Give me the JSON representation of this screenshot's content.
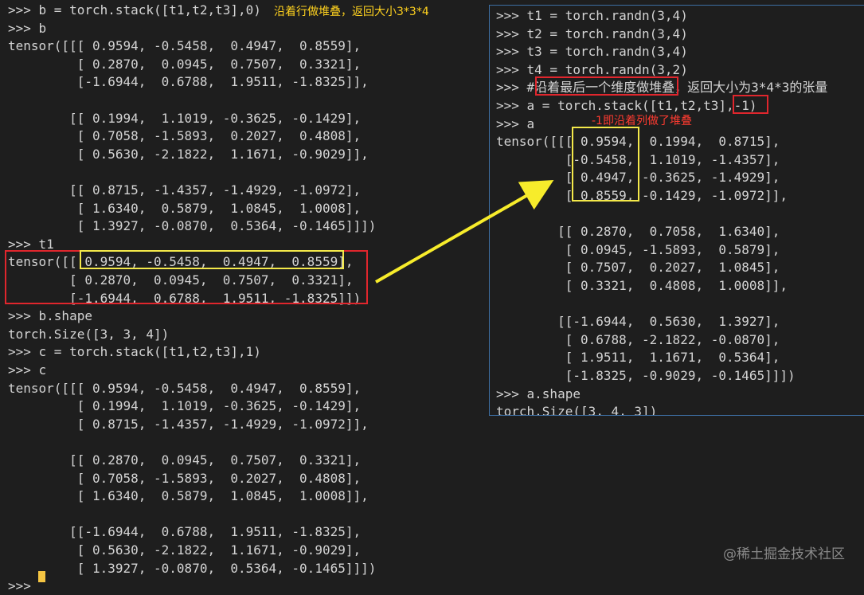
{
  "left": {
    "lines": [
      ">>> b = torch.stack([t1,t2,t3],0)",
      ">>> b",
      "tensor([[[ 0.9594, -0.5458,  0.4947,  0.8559],",
      "         [ 0.2870,  0.0945,  0.7507,  0.3321],",
      "         [-1.6944,  0.6788,  1.9511, -1.8325]],",
      "",
      "        [[ 0.1994,  1.1019, -0.3625, -0.1429],",
      "         [ 0.7058, -1.5893,  0.2027,  0.4808],",
      "         [ 0.5630, -2.1822,  1.1671, -0.9029]],",
      "",
      "        [[ 0.8715, -1.4357, -1.4929, -1.0972],",
      "         [ 1.6340,  0.5879,  1.0845,  1.0008],",
      "         [ 1.3927, -0.0870,  0.5364, -0.1465]]])",
      ">>> t1",
      "tensor([[ 0.9594, -0.5458,  0.4947,  0.8559],",
      "        [ 0.2870,  0.0945,  0.7507,  0.3321],",
      "        [-1.6944,  0.6788,  1.9511, -1.8325]])",
      ">>> b.shape",
      "torch.Size([3, 3, 4])",
      ">>> c = torch.stack([t1,t2,t3],1)",
      ">>> c",
      "tensor([[[ 0.9594, -0.5458,  0.4947,  0.8559],",
      "         [ 0.1994,  1.1019, -0.3625, -0.1429],",
      "         [ 0.8715, -1.4357, -1.4929, -1.0972]],",
      "",
      "        [[ 0.2870,  0.0945,  0.7507,  0.3321],",
      "         [ 0.7058, -1.5893,  0.2027,  0.4808],",
      "         [ 1.6340,  0.5879,  1.0845,  1.0008]],",
      "",
      "        [[-1.6944,  0.6788,  1.9511, -1.8325],",
      "         [ 0.5630, -2.1822,  1.1671, -0.9029],",
      "         [ 1.3927, -0.0870,  0.5364, -0.1465]]])",
      ">>> "
    ],
    "annotation": "沿着行做堆叠，返回大小3*3*4"
  },
  "right": {
    "lines": [
      ">>> t1 = torch.randn(3,4)",
      ">>> t2 = torch.randn(3,4)",
      ">>> t3 = torch.randn(3,4)",
      ">>> t4 = torch.randn(3,2)",
      ">>> #沿着最后一个维度做堆叠，返回大小为3*4*3的张量",
      ">>> a = torch.stack([t1,t2,t3],-1)",
      ">>> a",
      "tensor([[[ 0.9594,  0.1994,  0.8715],",
      "         [-0.5458,  1.1019, -1.4357],",
      "         [ 0.4947, -0.3625, -1.4929],",
      "         [ 0.8559, -0.1429, -1.0972]],",
      "",
      "        [[ 0.2870,  0.7058,  1.6340],",
      "         [ 0.0945, -1.5893,  0.5879],",
      "         [ 0.7507,  0.2027,  1.0845],",
      "         [ 0.3321,  0.4808,  1.0008]],",
      "",
      "        [[-1.6944,  0.5630,  1.3927],",
      "         [ 0.6788, -2.1822, -0.0870],",
      "         [ 1.9511,  1.1671,  0.5364],",
      "         [-1.8325, -0.9029, -0.1465]]])",
      ">>> a.shape",
      "torch.Size([3, 4, 3])"
    ],
    "annotation": "-1即沿着列做了堆叠"
  },
  "watermark": "@稀土掘金技术社区",
  "colors": {
    "background": "#1e1e1e",
    "red_box": "#e0262d",
    "yellow_box": "#f4e94a",
    "arrow": "#f7ec2b"
  }
}
